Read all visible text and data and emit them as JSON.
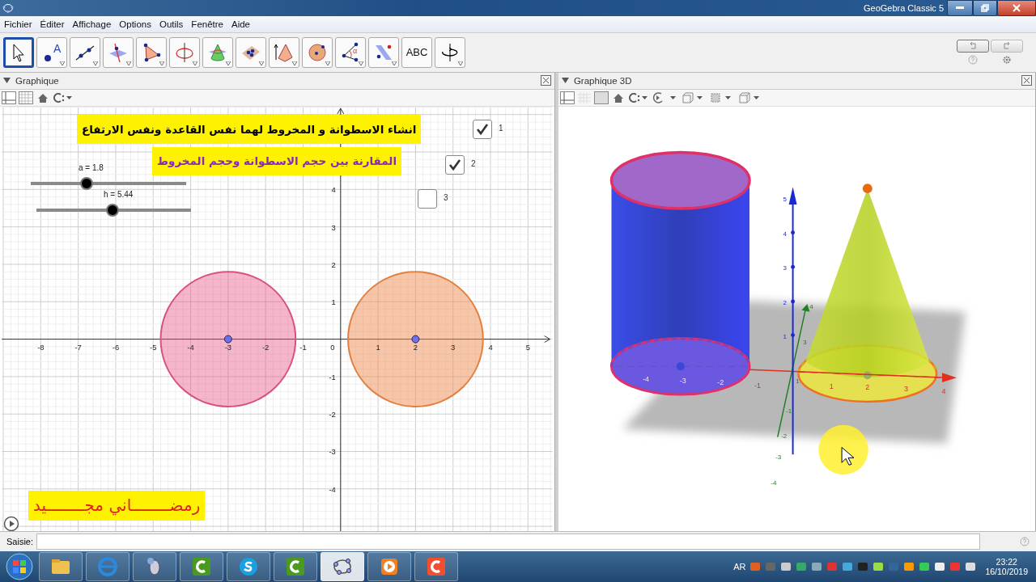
{
  "window": {
    "title": "GeoGebra Classic 5"
  },
  "menu": [
    "Fichier",
    "Éditer",
    "Affichage",
    "Options",
    "Outils",
    "Fenêtre",
    "Aide"
  ],
  "toolbar": [
    {
      "kind": "move",
      "selected": true
    },
    {
      "kind": "point",
      "label": "A",
      "selected": false
    },
    {
      "kind": "line",
      "selected": false
    },
    {
      "kind": "perpendicular",
      "selected": false
    },
    {
      "kind": "polygon",
      "selected": false
    },
    {
      "kind": "axis-circle",
      "selected": false
    },
    {
      "kind": "intersect",
      "selected": false
    },
    {
      "kind": "plane",
      "selected": false
    },
    {
      "kind": "pyramid",
      "selected": false
    },
    {
      "kind": "sphere",
      "selected": false
    },
    {
      "kind": "angle",
      "label": "α",
      "selected": false
    },
    {
      "kind": "reflect",
      "selected": false
    },
    {
      "kind": "text",
      "label": "ABC",
      "selected": false
    },
    {
      "kind": "rotate",
      "selected": false
    }
  ],
  "graphics": {
    "title": "Graphique",
    "headline": "انشاء الاسطوانة و المخروط لهما نفس القاعدة ونفس الارتفاع",
    "subtitle": "المقارنة بين حجم الاسطوانة وحجم المخروط",
    "signature": "رمضــــــــاني مجــــــــيد",
    "sliders": [
      {
        "label": "a = 1.8",
        "level": 0.36
      },
      {
        "label": "h = 5.44",
        "level": 0.49
      }
    ],
    "checkboxes": [
      {
        "label": "1",
        "checked": true
      },
      {
        "label": "2",
        "checked": true
      },
      {
        "label": "3",
        "checked": false
      }
    ],
    "x_ticks": [
      "-8",
      "-7",
      "-6",
      "-5",
      "-4",
      "-3",
      "-2",
      "-1",
      "0",
      "1",
      "2",
      "3",
      "4",
      "5"
    ],
    "y_ticks": [
      "4",
      "3",
      "2",
      "1",
      "-1",
      "-2",
      "-3",
      "-4"
    ]
  },
  "graphics3d": {
    "title": "Graphique 3D",
    "z_ticks": [
      "5",
      "4",
      "3",
      "2",
      "1"
    ],
    "x_ticks": [
      "-4",
      "-3",
      "-2",
      "-1",
      "1",
      "2",
      "3",
      "4"
    ],
    "y_ticks": [
      "4",
      "3",
      "1",
      "-1",
      "-2",
      "-3",
      "-4"
    ]
  },
  "input_bar": {
    "label": "Saisie:"
  },
  "taskbar": {
    "language": "AR",
    "time": "23:22",
    "date": "16/10/2019"
  }
}
